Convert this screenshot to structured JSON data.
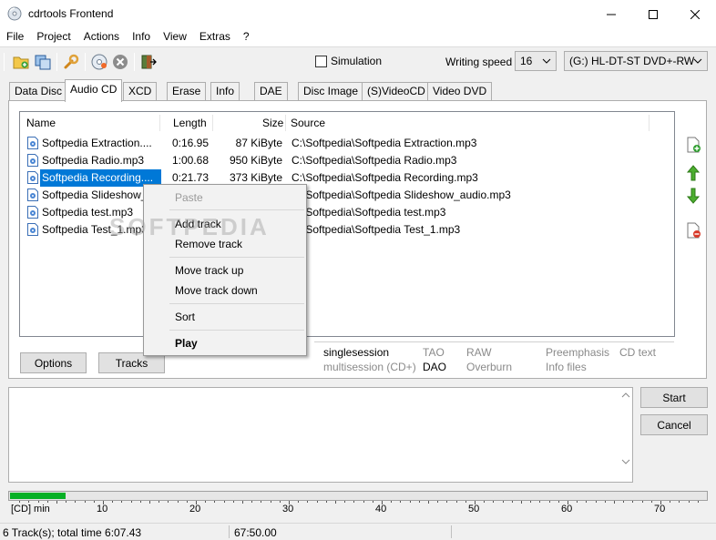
{
  "window": {
    "title": "cdrtools Frontend",
    "minimize_icon": "minimize-icon",
    "maximize_icon": "maximize-icon",
    "close_icon": "close-icon"
  },
  "menu": [
    "File",
    "Project",
    "Actions",
    "Info",
    "View",
    "Extras",
    "?"
  ],
  "toolbar": {
    "icons": [
      "folder-add-icon",
      "folder-copy-icon",
      "settings-wrench-icon",
      "burn-disc-icon",
      "cancel-disc-icon",
      "exit-icon"
    ],
    "simulation_label": "Simulation",
    "simulation_checked": false,
    "writing_speed_label": "Writing speed",
    "writing_speed_value": "16",
    "drive_value": "(G:) HL-DT-ST DVD+-RW"
  },
  "tabs": [
    "Data Disc",
    "Audio CD",
    "XCD",
    "Erase",
    "Info",
    "DAE",
    "Disc Image",
    "(S)VideoCD",
    "Video DVD"
  ],
  "active_tab": "Audio CD",
  "tracklist": {
    "columns": [
      "Name",
      "Length",
      "Size",
      "Source"
    ],
    "rows": [
      {
        "name": "Softpedia Extraction....",
        "length": "0:16.95",
        "size": "87 KiByte",
        "source": "C:\\Softpedia\\Softpedia Extraction.mp3"
      },
      {
        "name": "Softpedia Radio.mp3",
        "length": "1:00.68",
        "size": "950 KiByte",
        "source": "C:\\Softpedia\\Softpedia Radio.mp3"
      },
      {
        "name": "Softpedia Recording....",
        "length": "0:21.73",
        "size": "373 KiByte",
        "source": "C:\\Softpedia\\Softpedia Recording.mp3"
      },
      {
        "name": "Softpedia Slideshow_",
        "length": "",
        "size": "",
        "source": "C:\\Softpedia\\Softpedia Slideshow_audio.mp3"
      },
      {
        "name": "Softpedia test.mp3",
        "length": "",
        "size": "",
        "source": "C:\\Softpedia\\Softpedia test.mp3"
      },
      {
        "name": "Softpedia Test_1.mp3",
        "length": "",
        "size": "",
        "source": "C:\\Softpedia\\Softpedia Test_1.mp3"
      }
    ],
    "selected_row": 2
  },
  "side_icons": [
    "add-file-icon",
    "move-up-icon",
    "move-down-icon",
    "remove-file-icon"
  ],
  "context_menu": {
    "paste": "Paste",
    "add_track": "Add track",
    "remove_track": "Remove track",
    "move_up": "Move track up",
    "move_down": "Move track down",
    "sort": "Sort",
    "play": "Play"
  },
  "buttons": {
    "options": "Options",
    "tracks": "Tracks",
    "start": "Start",
    "cancel": "Cancel"
  },
  "info_panel": {
    "singlesession": "singlesession",
    "multisession": "multisession (CD+)",
    "tao": "TAO",
    "dao": "DAO",
    "raw": "RAW",
    "overburn": "Overburn",
    "preemphasis": "Preemphasis",
    "info_files": "Info files",
    "cd_text": "CD text"
  },
  "progress": {
    "fraction": 0.08,
    "unit_label": "[CD] min",
    "ticks": [
      "10",
      "20",
      "30",
      "40",
      "50",
      "60",
      "70"
    ]
  },
  "status": {
    "tracks": "6 Track(s); total time 6:07.43",
    "capacity": "67:50.00"
  },
  "watermark": "SOFTPEDIA"
}
